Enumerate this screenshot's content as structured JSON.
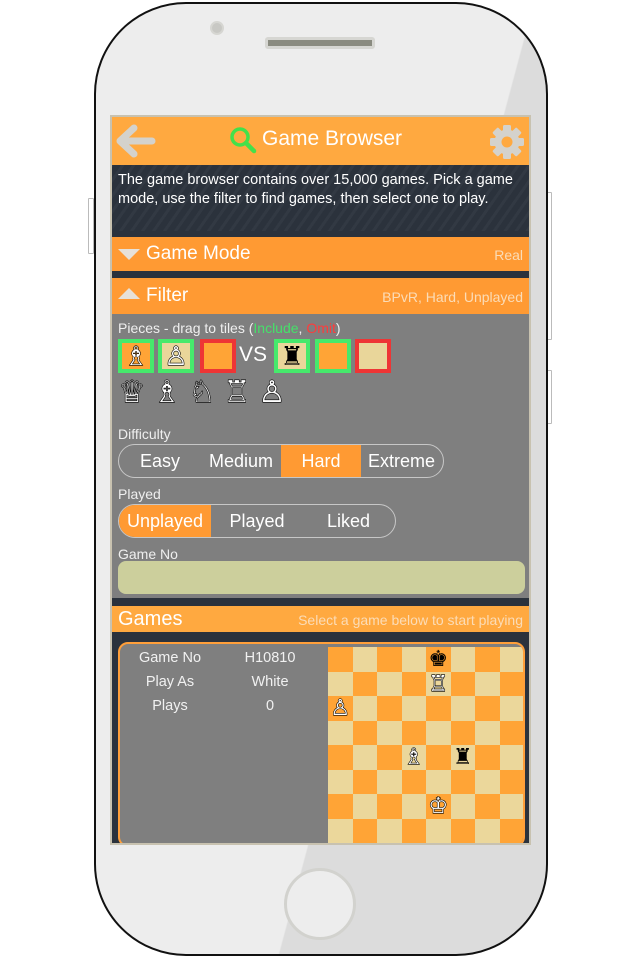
{
  "header": {
    "title": "Game Browser",
    "back_icon": "back-arrow-icon",
    "search_icon": "search-icon",
    "settings_icon": "gear-icon"
  },
  "intro_text": "The game browser contains over 15,000 games. Pick a game mode, use the filter to find games, then select one to play.",
  "game_mode": {
    "label": "Game Mode",
    "value": "Real",
    "expanded": false
  },
  "filter": {
    "label": "Filter",
    "summary": "BPvR, Hard, Unplayed",
    "expanded": true,
    "pieces_label_prefix": "Pieces - drag to tiles (",
    "include_label": "Include",
    "separator": ", ",
    "omit_label": "Omit",
    "pieces_label_suffix": ")",
    "vs_label": "VS",
    "white_tiles": [
      {
        "mode": "include",
        "square": "orange",
        "piece": "white-bishop",
        "glyph": "♗"
      },
      {
        "mode": "include",
        "square": "tan",
        "piece": "white-pawn",
        "glyph": "♙"
      },
      {
        "mode": "omit",
        "square": "orange",
        "piece": "",
        "glyph": ""
      }
    ],
    "black_tiles": [
      {
        "mode": "include",
        "square": "tan",
        "piece": "black-rook",
        "glyph": "♜"
      },
      {
        "mode": "include",
        "square": "orange",
        "piece": "",
        "glyph": ""
      },
      {
        "mode": "omit",
        "square": "tan",
        "piece": "",
        "glyph": ""
      }
    ],
    "palette": [
      {
        "piece": "queen",
        "glyph": "♕"
      },
      {
        "piece": "bishop",
        "glyph": "♗"
      },
      {
        "piece": "knight",
        "glyph": "♘"
      },
      {
        "piece": "rook",
        "glyph": "♖"
      },
      {
        "piece": "pawn",
        "glyph": "♙"
      }
    ],
    "difficulty": {
      "label": "Difficulty",
      "options": [
        "Easy",
        "Medium",
        "Hard",
        "Extreme"
      ],
      "selected": "Hard"
    },
    "played": {
      "label": "Played",
      "options": [
        "Unplayed",
        "Played",
        "Liked"
      ],
      "selected": "Unplayed"
    },
    "game_no": {
      "label": "Game No",
      "value": "",
      "placeholder": ""
    }
  },
  "games": {
    "label": "Games",
    "hint": "Select a game below to start playing",
    "items": [
      {
        "fields": [
          {
            "key": "Game No",
            "value": "H10810"
          },
          {
            "key": "Play As",
            "value": "White"
          },
          {
            "key": "Plays",
            "value": "0"
          }
        ],
        "board": {
          "pieces": [
            {
              "square": "e8",
              "piece": "black-king",
              "glyph": "♚"
            },
            {
              "square": "e7",
              "piece": "white-rook",
              "glyph": "♖"
            },
            {
              "square": "a6",
              "piece": "white-pawn",
              "glyph": "♙"
            },
            {
              "square": "d4",
              "piece": "white-bishop",
              "glyph": "♗"
            },
            {
              "square": "f4",
              "piece": "black-rook",
              "glyph": "♜"
            },
            {
              "square": "e2",
              "piece": "white-king",
              "glyph": "♔"
            }
          ]
        }
      }
    ]
  },
  "colors": {
    "header_orange": "#ffa940",
    "section_orange": "#ff9a33",
    "panel_gray": "#7f7f7f",
    "dark_bg": "#2b323c",
    "include_green": "#46e96c",
    "omit_red": "#ee3535",
    "board_dark": "#ffa436",
    "board_light": "#ebd79b",
    "input_bg": "#cccf9c"
  }
}
